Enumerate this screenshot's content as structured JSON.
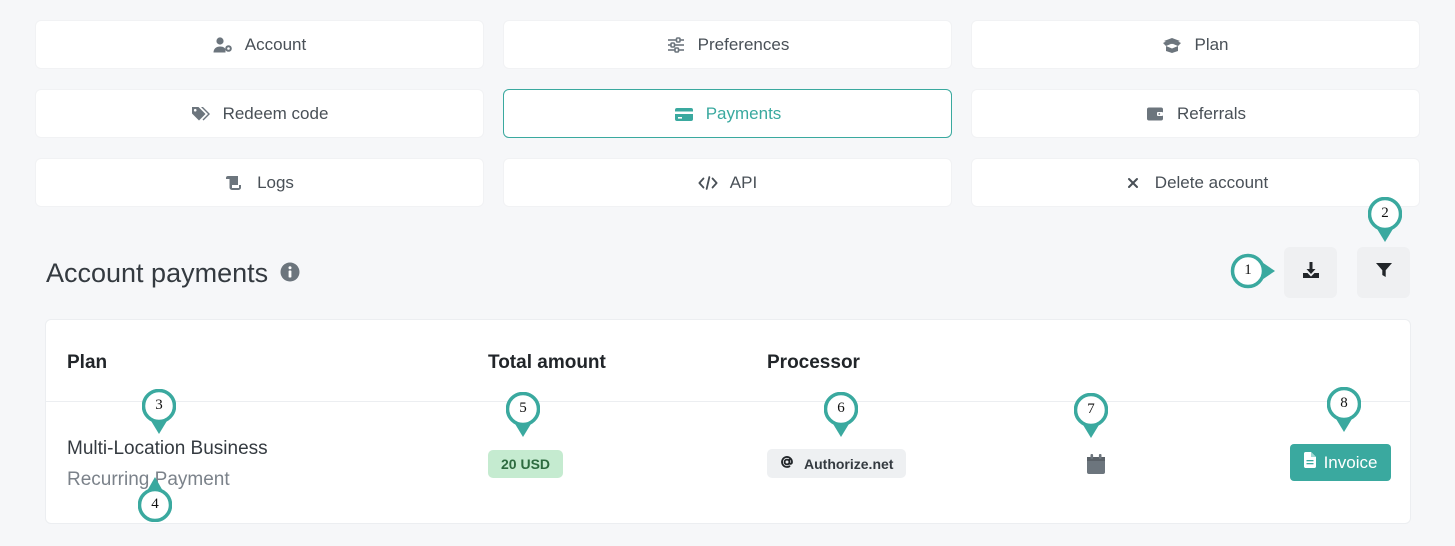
{
  "nav": {
    "account": "Account",
    "preferences": "Preferences",
    "plan": "Plan",
    "redeem": "Redeem code",
    "payments": "Payments",
    "referrals": "Referrals",
    "logs": "Logs",
    "api": "API",
    "delete": "Delete account"
  },
  "page": {
    "title": "Account payments"
  },
  "table": {
    "headers": {
      "plan": "Plan",
      "total": "Total amount",
      "processor": "Processor"
    },
    "rows": [
      {
        "plan_name": "Multi-Location Business",
        "plan_type": "Recurring Payment",
        "amount": "20 USD",
        "processor": "Authorize.net",
        "action": "Invoice"
      }
    ]
  },
  "markers": [
    "1",
    "2",
    "3",
    "4",
    "5",
    "6",
    "7",
    "8"
  ],
  "colors": {
    "accent": "#3aa99f",
    "amount_badge": "#c5ebd0",
    "marker_stroke": "#3aa99f"
  }
}
